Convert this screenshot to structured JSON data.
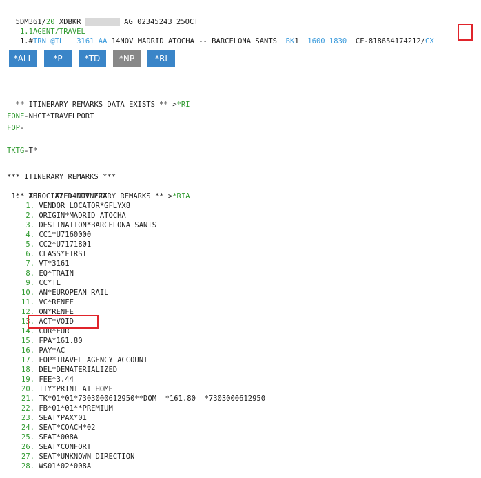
{
  "header": {
    "pnr_prefix": "5DM361/",
    "pnr_slash": "20",
    "pnr_mid": " XDBKR ",
    "pnr_suffix": " AG 02345243 25OCT"
  },
  "agent_line": {
    "num": " 1.",
    "text": "1AGENT/TRAVEL"
  },
  "segment": {
    "num": " 1.#",
    "trn": "TRN @TL",
    "train_no": "3161 AA",
    "route": "14NOV MADRID ATOCHA -- BARCELONA SANTS",
    "status_code": "BK",
    "status_qty": "1",
    "times": "1600 1830",
    "conf": "CF-818654174212/",
    "cx": "CX"
  },
  "buttons": [
    "*ALL",
    "*P",
    "*TD",
    "*NP",
    "*RI"
  ],
  "remarks_exist": {
    "text": "** ITINERARY REMARKS DATA EXISTS ** >",
    "link": "*RI"
  },
  "fone": {
    "key": "FONE",
    "value": "-NHCT*TRAVELPORT"
  },
  "fop": {
    "key": "FOP",
    "value": "-"
  },
  "tktg": {
    "key": "TKTG",
    "value": "-T*"
  },
  "itin_header": "*** ITINERARY REMARKS ***",
  "assoc_header": {
    "text": "** ASSOCIATED ITINERARY REMARKS ** >",
    "link": "*RIA"
  },
  "tur_line": " 1.  TUR   ZZ 14NOV ZZZ",
  "remarks": [
    {
      "n": "1.",
      "t": "VENDOR LOCATOR*GFLYX8"
    },
    {
      "n": "2.",
      "t": "ORIGIN*MADRID ATOCHA"
    },
    {
      "n": "3.",
      "t": "DESTINATION*BARCELONA SANTS"
    },
    {
      "n": "4.",
      "t": "CC1*U7160000"
    },
    {
      "n": "5.",
      "t": "CC2*U7171801"
    },
    {
      "n": "6.",
      "t": "CLASS*FIRST"
    },
    {
      "n": "7.",
      "t": "VT*3161"
    },
    {
      "n": "8.",
      "t": "EQ*TRAIN"
    },
    {
      "n": "9.",
      "t": "CC*TL"
    },
    {
      "n": "10.",
      "t": "AN*EUROPEAN RAIL"
    },
    {
      "n": "11.",
      "t": "VC*RENFE"
    },
    {
      "n": "12.",
      "t": "ON*RENFE"
    },
    {
      "n": "13.",
      "t": "ACT*VOID"
    },
    {
      "n": "14.",
      "t": "CUR*EUR"
    },
    {
      "n": "15.",
      "t": "FPA*161.80"
    },
    {
      "n": "16.",
      "t": "PAY*AC"
    },
    {
      "n": "17.",
      "t": "FOP*TRAVEL AGENCY ACCOUNT"
    },
    {
      "n": "18.",
      "t": "DEL*DEMATERIALIZED"
    },
    {
      "n": "19.",
      "t": "FEE*3.44"
    },
    {
      "n": "20.",
      "t": "TTY*PRINT AT HOME"
    },
    {
      "n": "21.",
      "t": "TK*01*01*7303000612950**DOM  *161.80  *7303000612950"
    },
    {
      "n": "22.",
      "t": "FB*01*01**PREMIUM"
    },
    {
      "n": "23.",
      "t": "SEAT*PAX*01"
    },
    {
      "n": "24.",
      "t": "SEAT*COACH*02"
    },
    {
      "n": "25.",
      "t": "SEAT*008A"
    },
    {
      "n": "26.",
      "t": "SEAT*CONFORT"
    },
    {
      "n": "27.",
      "t": "SEAT*UNKNOWN DIRECTION"
    },
    {
      "n": "28.",
      "t": "WS01*02*008A"
    }
  ],
  "colors": {
    "green": "#2f9a2f",
    "blue": "#3b9bdc",
    "button": "#3a85c8",
    "button_gray": "#888888",
    "highlight": "#e0242b"
  }
}
